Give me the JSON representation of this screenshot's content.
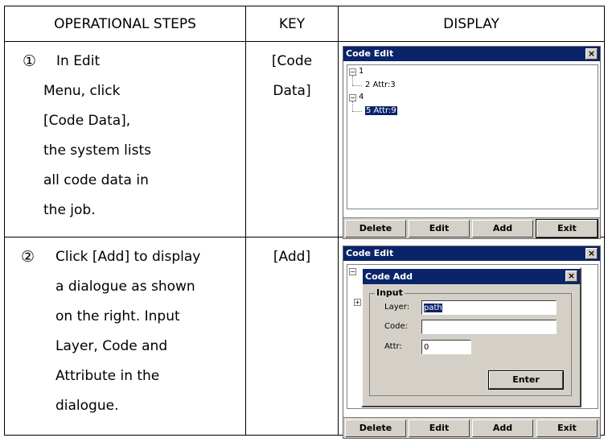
{
  "header": {
    "col1": "OPERATIONAL STEPS",
    "col2": "KEY",
    "col3": "DISPLAY"
  },
  "steps": [
    {
      "number": "①",
      "lines": [
        "In Edit",
        "Menu, click",
        "[Code Data],",
        "the system lists",
        "all code data in",
        "the job."
      ],
      "key_lines": [
        "[Code",
        "Data]"
      ]
    },
    {
      "number": "②",
      "lines": [
        "Click [Add] to display",
        "a dialogue as shown",
        "on the right. Input",
        "Layer, Code and",
        "Attribute in the",
        "dialogue."
      ],
      "key_lines": [
        "[Add]"
      ]
    }
  ],
  "screen1": {
    "title": "Code Edit",
    "close": "×",
    "tree": [
      {
        "label": "1",
        "expander": "−"
      },
      {
        "label": "2  Attr:3"
      },
      {
        "label": "4",
        "expander": "−"
      },
      {
        "label": "5  Attr:9",
        "selected": true
      }
    ],
    "buttons": [
      "Delete",
      "Edit",
      "Add",
      "Exit"
    ]
  },
  "screen2": {
    "title": "Code Edit",
    "close": "×",
    "buttons": [
      "Delete",
      "Edit",
      "Add",
      "Exit"
    ],
    "dialog": {
      "title": "Code Add",
      "close": "×",
      "group_label": "Input",
      "layer_label": "Layer:",
      "layer_value": "path",
      "code_label": "Code:",
      "code_value": "",
      "attr_label": "Attr:",
      "attr_value": "0",
      "enter_label": "Enter"
    }
  }
}
